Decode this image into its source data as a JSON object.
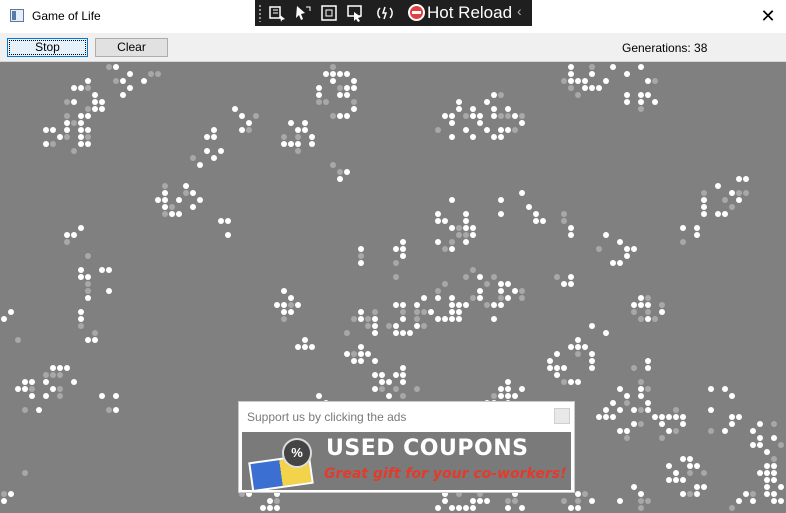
{
  "window": {
    "title": "Game of Life",
    "icons": {
      "app": "app-window-icon",
      "close": "close-icon"
    },
    "close_glyph": "✕"
  },
  "hot_reload": {
    "label": "Hot Reload",
    "collapse_glyph": "‹",
    "icons": [
      "grip-icon",
      "live-visual-tree-icon",
      "select-element-icon",
      "display-layout-adorners-icon",
      "track-focus-icon",
      "hot-reload-icon",
      "stop-icon",
      "collapse-icon"
    ]
  },
  "toolbar": {
    "stop_label": "Stop",
    "clear_label": "Clear",
    "generations_label": "Generations: 38"
  },
  "ad": {
    "header": "Support us by clicking the ads",
    "title": "USED COUPONS",
    "subtitle": "Great gift for your co-workers!",
    "badge": "%"
  },
  "colors": {
    "board": "#808080",
    "cell_alive": "#ffffff",
    "cell_fading": "#a8a8a8",
    "hot_reload_bg": "#1f1f1f"
  }
}
